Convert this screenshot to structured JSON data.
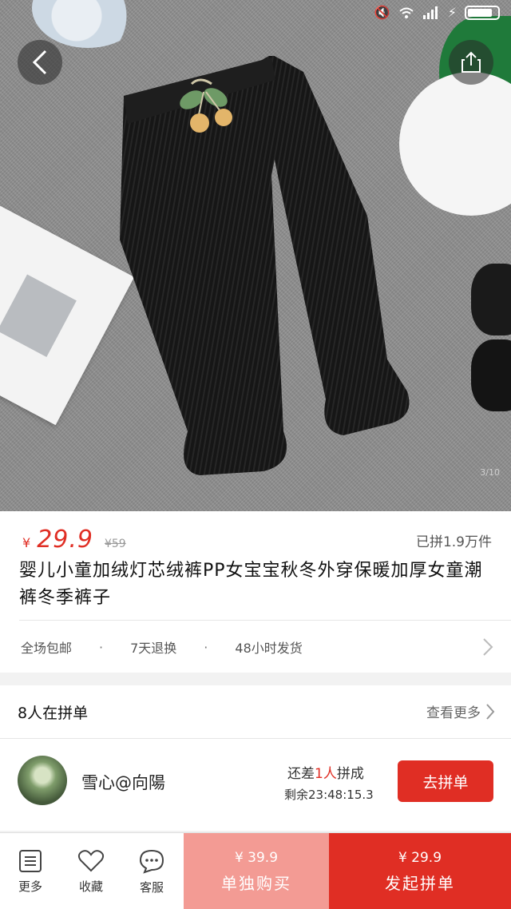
{
  "status_bar": {
    "icons": [
      "mute-icon",
      "wifi-icon",
      "signal-icon",
      "charging-icon",
      "battery-icon"
    ]
  },
  "hero": {
    "watermark": "3/10"
  },
  "product": {
    "currency": "¥",
    "price": "29.9",
    "original_price": "¥59",
    "sold": "已拼1.9万件",
    "title": "婴儿小童加绒灯芯绒裤PP女宝宝秋冬外穿保暖加厚女童潮裤冬季裤子",
    "services": [
      "全场包邮",
      "7天退换",
      "48小时发货"
    ],
    "service_separator": "·"
  },
  "group": {
    "header": "8人在拼单",
    "more": "查看更多",
    "member": {
      "name": "雪心@向陽",
      "need_prefix": "还差",
      "need_count": "1人",
      "need_suffix": "拼成",
      "remaining": "剩余23:48:15.3",
      "join_label": "去拼单"
    }
  },
  "bottom_bar": {
    "tools": [
      {
        "label": "更多",
        "icon": "list-icon"
      },
      {
        "label": "收藏",
        "icon": "heart-icon"
      },
      {
        "label": "客服",
        "icon": "chat-icon"
      }
    ],
    "solo": {
      "price": "¥ 39.9",
      "label": "单独购买"
    },
    "group_buy": {
      "price": "¥ 29.9",
      "label": "发起拼单"
    }
  },
  "colors": {
    "accent": "#e02e24",
    "accent_light": "#f39b94",
    "background": "#f2f2f2"
  }
}
